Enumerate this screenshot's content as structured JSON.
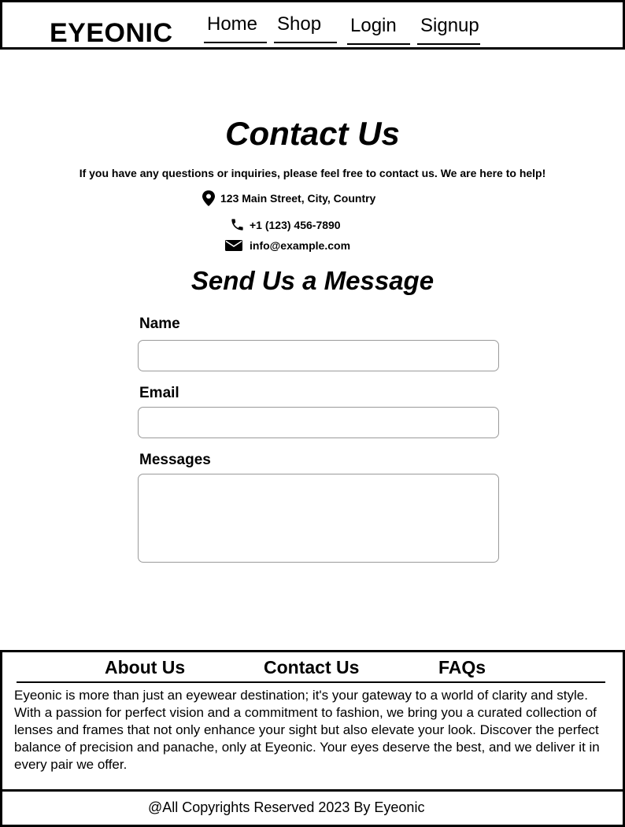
{
  "header": {
    "logo": "EYEONIC",
    "nav": [
      {
        "label": "Home"
      },
      {
        "label": "Shop"
      },
      {
        "label": "Login"
      },
      {
        "label": "Signup"
      }
    ]
  },
  "main": {
    "title": "Contact Us",
    "intro": "If you have any questions or inquiries, please feel free to contact us. We are here to help!",
    "address": "123 Main Street, City, Country",
    "phone": "+1 (123) 456-7890",
    "email": "info@example.com",
    "form_title": "Send Us a Message",
    "form": {
      "name_label": "Name",
      "name_value": "",
      "email_label": "Email",
      "email_value": "",
      "message_label": "Messages",
      "message_value": ""
    }
  },
  "footer": {
    "links": [
      {
        "label": "About Us"
      },
      {
        "label": "Contact Us"
      },
      {
        "label": "FAQs"
      }
    ],
    "description": "Eyeonic is more than just an eyewear destination; it's your gateway to a world of clarity and style. With a passion for perfect vision and a commitment to fashion, we bring you a curated collection of lenses and frames that not only enhance your sight but also elevate your look. Discover the perfect balance of precision and panache, only at Eyeonic. Your eyes deserve the best, and we deliver it in every pair we offer.",
    "copyright": "@All Copyrights Reserved 2023 By Eyeonic"
  },
  "icons": {
    "address": "map-pin-icon",
    "phone": "phone-icon",
    "email": "envelope-icon"
  }
}
